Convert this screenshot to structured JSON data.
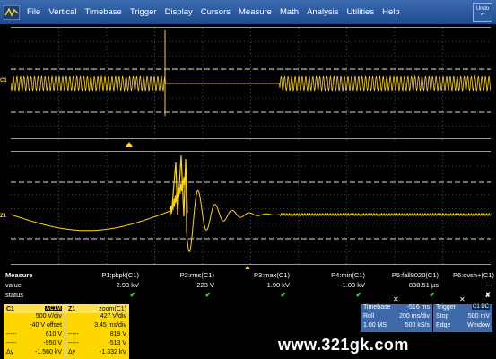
{
  "menu": {
    "items": [
      "File",
      "Vertical",
      "Timebase",
      "Trigger",
      "Display",
      "Cursors",
      "Measure",
      "Math",
      "Analysis",
      "Utilities",
      "Help"
    ],
    "undo_line1": "Undo",
    "undo_line2": "↶"
  },
  "grids": {
    "top_channel_label": "C1",
    "bottom_channel_label": "Z1",
    "trace_color": "#ffd700",
    "grid_color": "#777777"
  },
  "measure": {
    "label": "Measure",
    "value_label": "value",
    "status_label": "status",
    "params": [
      {
        "name": "P1:pkpk(C1)",
        "value": "2.93 kV",
        "status": "✔"
      },
      {
        "name": "P2:rms(C1)",
        "value": "223 V",
        "status": "✔"
      },
      {
        "name": "P3:max(C1)",
        "value": "1.90 kV",
        "status": "✔"
      },
      {
        "name": "P4:min(C1)",
        "value": "-1.03 kV",
        "status": "✔"
      },
      {
        "name": "P5:fall8020(C1)",
        "value": "838.51 µs",
        "status": "✔"
      },
      {
        "name": "P6:ovsh+(C1)",
        "value": "---",
        "status": "✘"
      }
    ]
  },
  "c1": {
    "name": "C1",
    "coupling": "AC1M",
    "vdiv": "500 V/div",
    "offset": "-40 V offset",
    "row3_label": "-----",
    "row3_value": "610 V",
    "row4_label": "-----",
    "row4_value": "-950 V",
    "delta_label": "Δy",
    "delta_value": "-1.560 kV"
  },
  "z1": {
    "name": "Z1",
    "title": "zoom(C1)",
    "vdiv": "427 V/div",
    "sdiv": "3.45 ms/div",
    "row3_label": "-----",
    "row3_value": "819 V",
    "row4_label": "-----",
    "row4_value": "-513 V",
    "delta_label": "Δy",
    "delta_value": "-1.332 kV"
  },
  "timebase": {
    "label": "Timebase",
    "delay": "-516 ms",
    "mode": "Roll",
    "tdiv": "200 ms/div",
    "points": "1.00 MS",
    "rate": "500 kS/s"
  },
  "trigger": {
    "label": "Trigger",
    "source": "C1 DC",
    "mode": "Stop",
    "level": "500 mV",
    "type": "Edge",
    "slope": "Window"
  },
  "watermark": "www.321gk.com"
}
